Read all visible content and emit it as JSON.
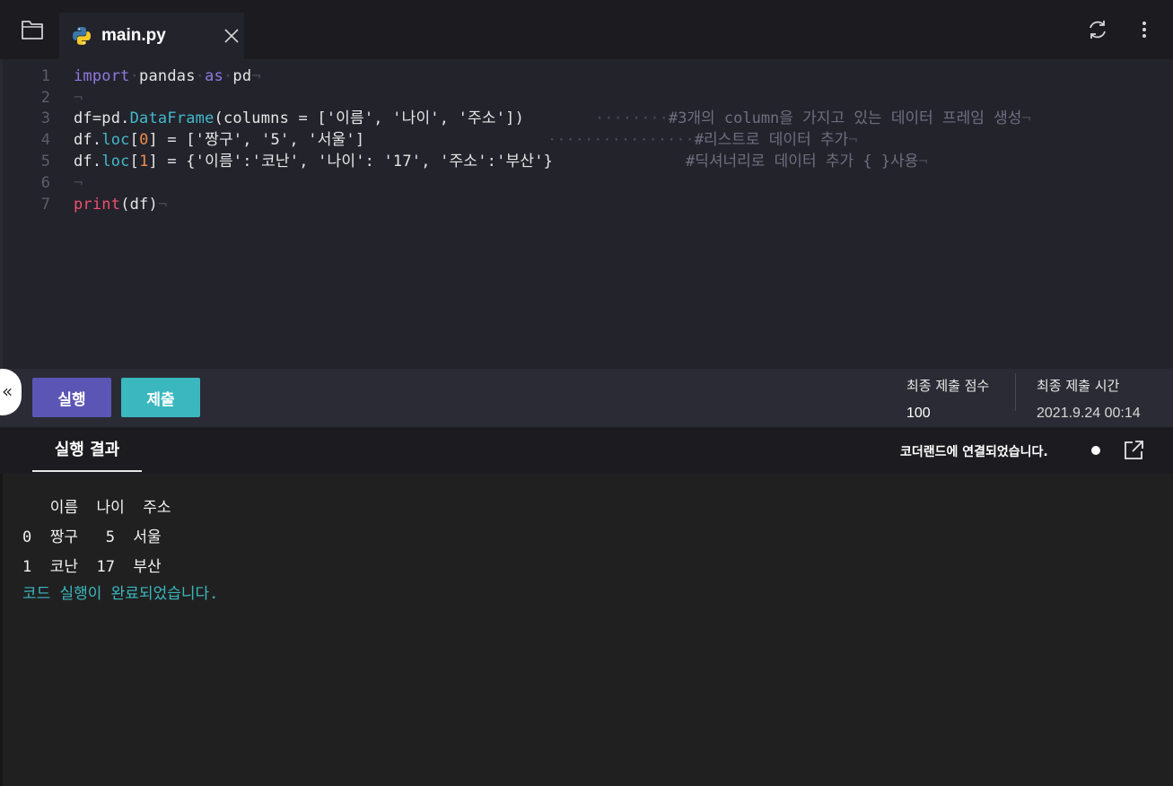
{
  "tab": {
    "filename": "main.py"
  },
  "editor": {
    "line_numbers": [
      "1",
      "2",
      "3",
      "4",
      "5",
      "6",
      "7"
    ],
    "eol_marker": "¬",
    "line1": {
      "kw_import": "import",
      "mod": "pandas",
      "kw_as": "as",
      "alias": "pd"
    },
    "line3": {
      "pre": "df=pd.",
      "fn": "DataFrame",
      "post": "(columns = ['이름', '나이', '주소'])",
      "leader": "········",
      "comment": "#3개의 column을 가지고 있는 데이터 프레임 생성"
    },
    "line4": {
      "pre": "df.",
      "fn": "loc",
      "lb": "[",
      "idx": "0",
      "post": "] = ['짱구', '5', '서울']",
      "leader": "················",
      "comment": "#리스트로 데이터 추가"
    },
    "line5": {
      "pre": "df.",
      "fn": "loc",
      "lb": "[",
      "idx": "1",
      "post": "] = {'이름':'코난', '나이': '17', '주소':'부산'}",
      "comment": "#딕셔너리로 데이터 추가 { }사용"
    },
    "line7": {
      "fn": "print",
      "post": "(df)"
    }
  },
  "controls": {
    "collapse_glyph": "«",
    "run_label": "실행",
    "submit_label": "제출",
    "score_label": "최종 제출 점수",
    "score_value": "100",
    "time_label": "최종 제출 시간",
    "time_value": "2021.9.24 00:14"
  },
  "result": {
    "tab_label": "실행 결과",
    "connection_status": "코더랜드에 연결되었습니다.",
    "output_lines": [
      "   이름  나이  주소",
      "0  짱구   5  서울",
      "1  코난  17  부산"
    ],
    "success_message": "코드 실행이 완료되었습니다."
  },
  "colors": {
    "run_button": "#5b55b5",
    "submit_button": "#3bb7bf",
    "keyword": "#8f7ae0",
    "function": "#43b8c9",
    "number": "#f08d49",
    "print_keyword": "#f0506e",
    "success_text": "#3bb7bf"
  },
  "icons": [
    "folder-icon",
    "python-icon",
    "close-icon",
    "refresh-icon",
    "more-vertical-icon",
    "external-link-icon"
  ]
}
